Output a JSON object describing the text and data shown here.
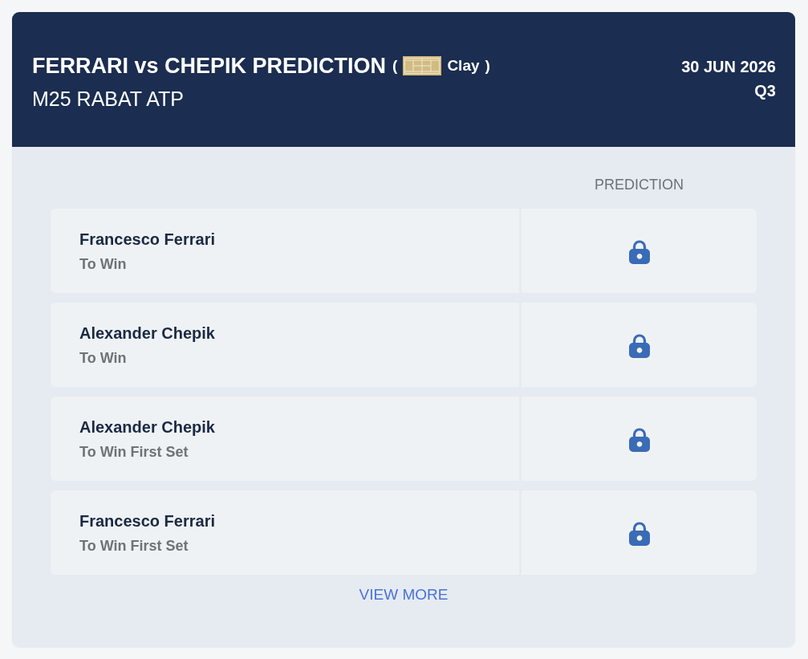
{
  "header": {
    "title": "FERRARI vs CHEPIK PREDICTION",
    "surface": {
      "open_paren": "(",
      "label": "Clay",
      "close_paren": ")"
    },
    "tournament": "M25 RABAT ATP",
    "date": "30 JUN 2026",
    "round": "Q3"
  },
  "table": {
    "prediction_column": "PREDICTION",
    "rows": [
      {
        "player": "Francesco Ferrari",
        "market": "To Win",
        "locked": true
      },
      {
        "player": "Alexander Chepik",
        "market": "To Win",
        "locked": true
      },
      {
        "player": "Alexander Chepik",
        "market": "To Win First Set",
        "locked": true
      },
      {
        "player": "Francesco Ferrari",
        "market": "To Win First Set",
        "locked": true
      }
    ]
  },
  "view_more": "VIEW MORE"
}
